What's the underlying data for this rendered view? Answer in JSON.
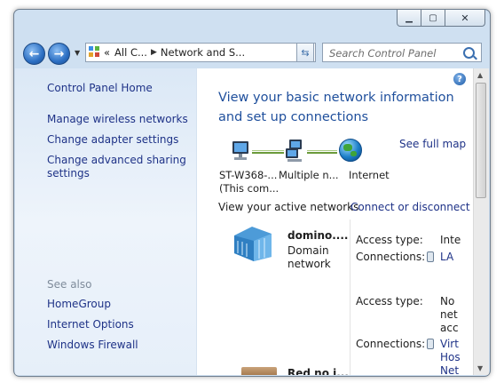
{
  "navigation": {
    "back_symbol": "←",
    "forward_symbol": "→",
    "address": {
      "prefix": "«",
      "crumb1": "All C...",
      "crumb2": "Network and S...",
      "separator": "▶"
    },
    "search_placeholder": "Search Control Panel"
  },
  "left_pane": {
    "home": "Control Panel Home",
    "tasks": [
      "Manage wireless networks",
      "Change adapter settings",
      "Change advanced sharing",
      "settings"
    ],
    "see_also_title": "See also",
    "see_also": [
      "HomeGroup",
      "Internet Options",
      "Windows Firewall"
    ]
  },
  "main": {
    "help_symbol": "?",
    "heading_line1": "View your basic network information",
    "heading_line2": "and set up connections",
    "see_full_map": "See full map",
    "nodes": {
      "computer_line1": "ST-W368-...",
      "computer_line2": "(This com...",
      "multiple": "Multiple n...",
      "internet": "Internet"
    },
    "active_networks_label": "View your active networks",
    "connect_disconnect": "Connect or disconnect",
    "network1": {
      "name": "domino....",
      "type_line1": "Domain",
      "type_line2": "network",
      "access_label": "Access type:",
      "access_value": "Inte",
      "connections_label": "Connections:",
      "connections_value": "LA"
    },
    "network2": {
      "access_label": "Access type:",
      "access_lines": [
        "No",
        "net",
        "acc"
      ],
      "connections_label": "Connections:",
      "connections_lines": [
        "Virt",
        "Hos",
        "Net"
      ]
    },
    "network3": {
      "name": "Red no i..."
    }
  },
  "icons": {
    "computer": "computer-icon",
    "network": "network-icon",
    "internet": "globe-icon",
    "domain": "domain-network-icon",
    "cable": "ethernet-icon",
    "help": "help-icon",
    "refresh": "refresh-icon",
    "search": "search-icon"
  },
  "colors": {
    "link": "#1e3287",
    "heading": "#1f4f9c",
    "frame": "#cfe0f1"
  }
}
